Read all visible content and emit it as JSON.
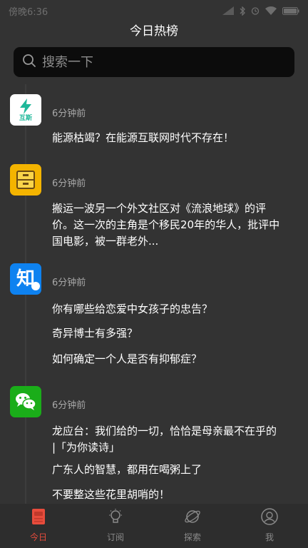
{
  "status_bar": {
    "left_text": "傍晚6:36",
    "icons": [
      "signal-icon",
      "bluetooth-icon",
      "alarm-icon",
      "wifi-icon",
      "battery-icon"
    ]
  },
  "header": {
    "title": "今日热榜"
  },
  "search": {
    "placeholder": "搜索一下",
    "value": ""
  },
  "feed": {
    "groups": [
      {
        "icon": "hushi-icon",
        "icon_text": "互斯",
        "icon_color": "#ffffff",
        "time": "6分钟前",
        "items": [
          "能源枯竭？在能源互联网时代不存在！"
        ]
      },
      {
        "icon": "drawer-icon",
        "icon_color": "#f4b400",
        "time": "6分钟前",
        "items": [
          "搬运一波另一个外文社区对《流浪地球》的评价。这一次的主角是个移民20年的华人，批评中国电影，被一群老外..."
        ]
      },
      {
        "icon": "zhihu-icon",
        "icon_text": "知",
        "icon_color": "#0e82f0",
        "time": "6分钟前",
        "items": [
          "你有哪些给恋爱中女孩子的忠告？",
          "奇异博士有多强？",
          "如何确定一个人是否有抑郁症？"
        ]
      },
      {
        "icon": "wechat-icon",
        "icon_color": "#1aad19",
        "time": "6分钟前",
        "items": [
          "龙应台：我们给的一切，恰恰是母亲最不在乎的 |「为你读诗」",
          "广东人的智慧，都用在喝粥上了",
          "不要整这些花里胡哨的！"
        ]
      }
    ]
  },
  "tab_bar": {
    "tabs": [
      {
        "label": "今日",
        "icon": "today-icon",
        "active": true
      },
      {
        "label": "订阅",
        "icon": "lightbulb-icon",
        "active": false
      },
      {
        "label": "探索",
        "icon": "planet-icon",
        "active": false
      },
      {
        "label": "我",
        "icon": "user-icon",
        "active": false
      }
    ]
  },
  "colors": {
    "background": "#333333",
    "search_bg": "#0c0c0c",
    "accent_red": "#e74c3c",
    "muted": "#a9a9a9"
  }
}
